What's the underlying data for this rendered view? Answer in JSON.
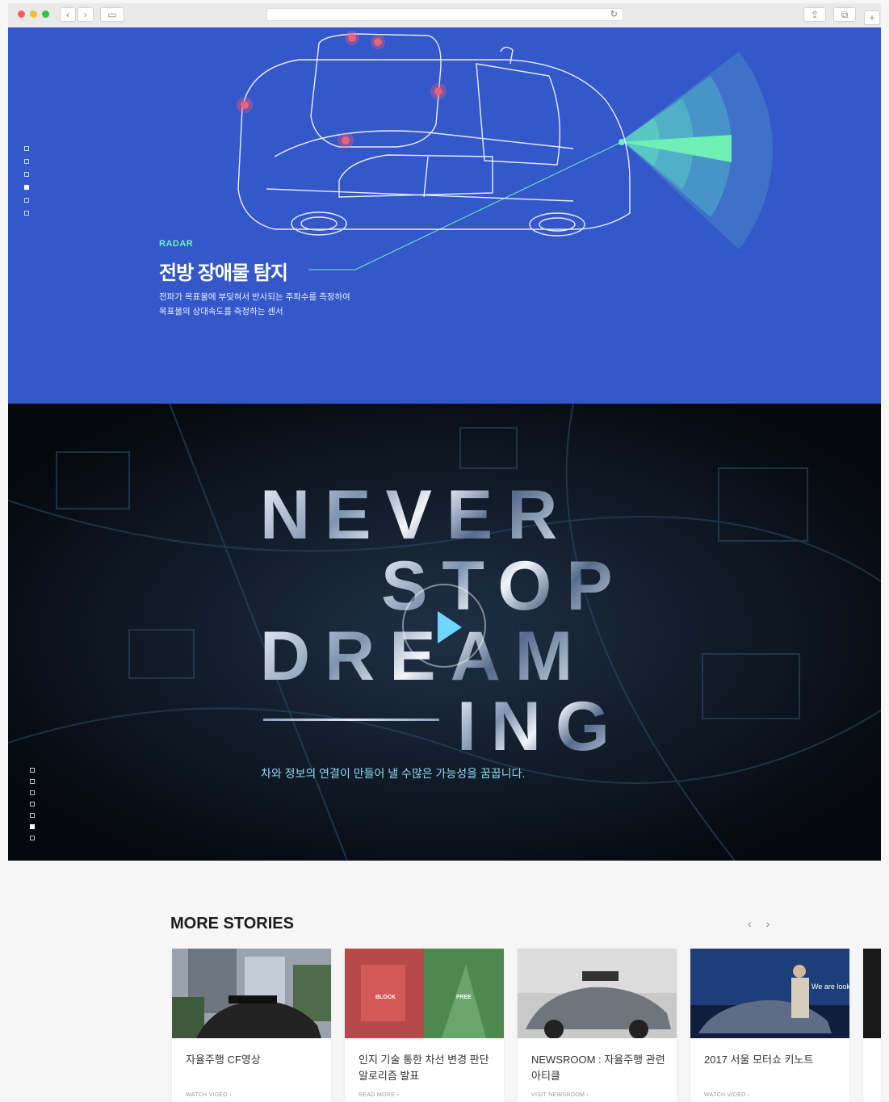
{
  "radar": {
    "tag": "RADAR",
    "title": "전방 장애물 탐지",
    "desc_line1": "전파가 목표물에 부딪혀서 반사되는 주파수를 측정하여",
    "desc_line2": "목표물의 상대속도를 측정하는 센서",
    "pager_active": 4
  },
  "video": {
    "words": [
      "NEVER",
      "STOP",
      "DREAM",
      "ING"
    ],
    "subtitle": "차와 정보의 연결이 만들어 낼 수많은 가능성을 꿈꿉니다.",
    "pager_active": 6
  },
  "stories": {
    "heading": "MORE STORIES",
    "prev_icon": "chevron-left-icon",
    "next_icon": "chevron-right-icon",
    "cards": [
      {
        "title": "자율주행 CF영상",
        "link": "WATCH VIDEO  ›"
      },
      {
        "title": "인지 기술 통한 차선 변경 판단 알로리즘 발표",
        "link": "READ MORE  ›"
      },
      {
        "title": "NEWSROOM : 자율주행 관련 아티클",
        "link": "VISIT NEWSROOM  ›"
      },
      {
        "title": "2017 서울 모터쇼 키노트",
        "link": "WATCH VIDEO  ›"
      }
    ],
    "card3_overlay": "We are look",
    "card2_left": "BLOCK",
    "card2_right": "FREE"
  },
  "colors": {
    "radar_bg": "#3457c9",
    "radar_accent": "#6ef0c4",
    "video_bg": "#0b1018",
    "play_color": "#6fd7ff"
  }
}
